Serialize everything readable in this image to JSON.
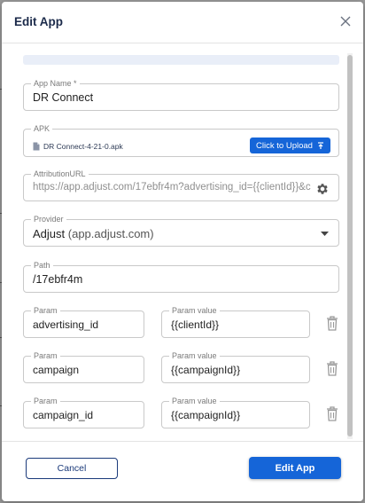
{
  "dialog": {
    "title": "Edit App"
  },
  "form": {
    "app_name": {
      "label": "App Name *",
      "value": "DR Connect"
    },
    "apk": {
      "label": "APK",
      "file_name": "DR Connect-4-21-0.apk",
      "upload_label": "Click to Upload"
    },
    "attribution_url": {
      "label": "AttributionURL",
      "value": "https://app.adjust.com/17ebfr4m?advertising_id={{clientId}}&c"
    },
    "provider": {
      "label": "Provider",
      "value": "Adjust",
      "secondary": "(app.adjust.com)"
    },
    "path": {
      "label": "Path",
      "value": "/17ebfr4m"
    },
    "params": [
      {
        "param_label": "Param",
        "param": "advertising_id",
        "value_label": "Param value",
        "value": "{{clientId}}"
      },
      {
        "param_label": "Param",
        "param": "campaign",
        "value_label": "Param value",
        "value": "{{campaignId}}"
      },
      {
        "param_label": "Param",
        "param": "campaign_id",
        "value_label": "Param value",
        "value": "{{campaignId}}"
      }
    ]
  },
  "footer": {
    "cancel_label": "Cancel",
    "submit_label": "Edit App"
  },
  "icons": {
    "close": "close-icon",
    "file": "file-icon",
    "upload": "upload-icon",
    "gear": "gear-icon",
    "dropdown": "chevron-down-icon",
    "delete": "trash-icon"
  },
  "colors": {
    "primary": "#1565d8",
    "title": "#1b2a4a",
    "cancel_border": "#1b3a7a"
  }
}
